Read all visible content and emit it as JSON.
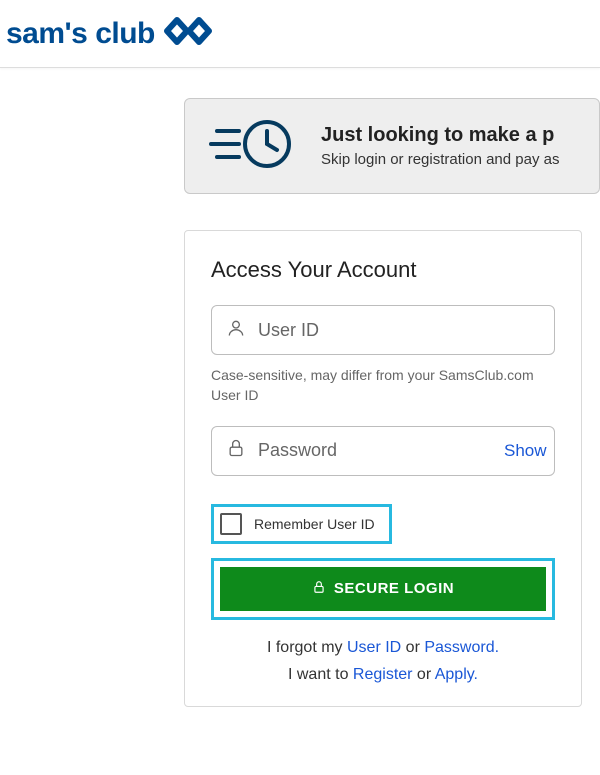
{
  "header": {
    "logo_text": "sam's club"
  },
  "banner": {
    "title": "Just looking to make a p",
    "subtitle": "Skip login or registration and pay as"
  },
  "login": {
    "title": "Access Your Account",
    "user_id_placeholder": "User ID",
    "user_id_hint": "Case-sensitive, may differ from your SamsClub.com User ID",
    "password_placeholder": "Password",
    "show_label": "Show",
    "remember_label": "Remember User ID",
    "submit_label": "SECURE LOGIN",
    "forgot_prefix": "I forgot my ",
    "forgot_userid": "User ID",
    "forgot_or": " or ",
    "forgot_password": "Password.",
    "want_prefix": "I want to ",
    "register": "Register",
    "apply_or": " or ",
    "apply": "Apply."
  }
}
